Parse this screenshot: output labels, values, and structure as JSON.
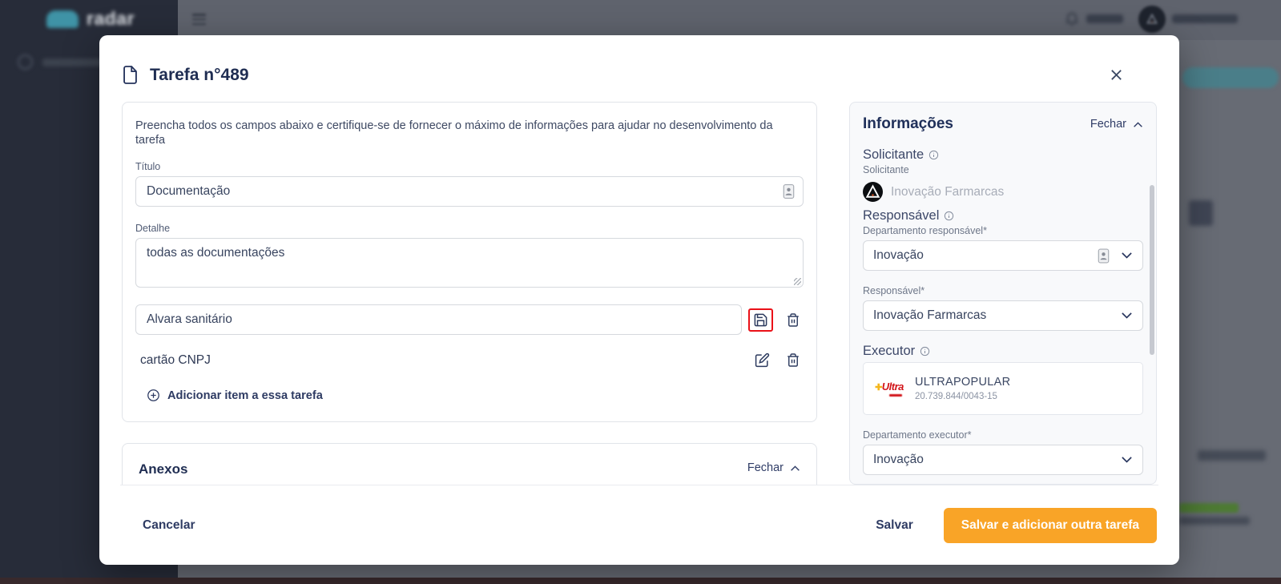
{
  "sidebar": {
    "brand": "radar"
  },
  "modal": {
    "title": "Tarefa n°489",
    "description": "Preencha todos os campos abaixo e certifique-se de fornecer o máximo de informações para ajudar no desenvolvimento da tarefa",
    "titulo": {
      "label": "Título",
      "value": "Documentação"
    },
    "detalhe": {
      "label": "Detalhe",
      "value": "todas as documentações"
    },
    "items": [
      {
        "text": "Alvara sanitário",
        "state": "editing"
      },
      {
        "text": "cartão CNPJ",
        "state": "saved"
      }
    ],
    "add_item_label": "Adicionar item a essa tarefa",
    "anexos": {
      "title": "Anexos",
      "collapse_label": "Fechar"
    }
  },
  "info_panel": {
    "title": "Informações",
    "collapse_label": "Fechar",
    "solicitante": {
      "heading": "Solicitante",
      "sublabel": "Solicitante",
      "value": "Inovação Farmarcas"
    },
    "responsavel": {
      "heading": "Responsável",
      "departamento_label": "Departamento responsável*",
      "departamento_value": "Inovação",
      "responsavel_label": "Responsável*",
      "responsavel_value": "Inovação Farmarcas"
    },
    "executor": {
      "heading": "Executor",
      "brand": "Ultra",
      "name": "ULTRAPOPULAR",
      "cnpj": "20.739.844/0043-15",
      "departamento_label": "Departamento executor*",
      "departamento_value": "Inovação"
    }
  },
  "footer": {
    "cancel": "Cancelar",
    "save": "Salvar",
    "save_and_add": "Salvar e adicionar outra tarefa"
  },
  "icons": {
    "modal_title": "document-icon",
    "close": "close-icon",
    "item_save": "save-floppy-icon",
    "item_delete": "trash-icon",
    "item_edit": "edit-pencil-icon",
    "add_item": "plus-circle-icon",
    "collapse": "chevron-up-icon",
    "select_open": "chevron-down-icon",
    "info": "info-circle-icon",
    "autofill": "autofill-badge-icon",
    "topbar": [
      "hamburger-menu-icon",
      "bell-icon",
      "avatar"
    ]
  },
  "colors": {
    "accent_orange": "#f9a427",
    "navy_text": "#1f2d52",
    "highlight_red": "#ea1118",
    "teal_button": "#4a7e89",
    "success_green": "#4d7a33",
    "sidebar_dark": "#272c39"
  }
}
